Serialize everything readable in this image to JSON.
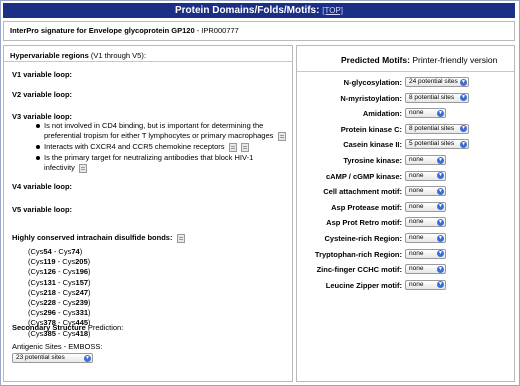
{
  "header": {
    "title": "Protein Domains/Folds/Motifs:",
    "top_link": "[TOP]"
  },
  "signature": {
    "title": "InterPro signature for Envelope glycoprotein GP120",
    "id": " - IPR000777"
  },
  "left": {
    "hypervariable_title": "Hypervariable regions",
    "hypervariable_sub": " (V1 through V5):",
    "loops": {
      "v1": "V1 variable loop:",
      "v2": "V2 variable loop:",
      "v3": "V3 variable loop:",
      "v4": "V4 variable loop:",
      "v5": "V5 variable loop:"
    },
    "v3_bullets": [
      "Is not involved in CD4 binding, but is important for determining the preferential tropism for either T lymphocytes or primary macrophages",
      "Interacts with CXCR4 and CCR5 chemokine receptors",
      "Is the primary target for neutralizing antibodies that block HIV-1 infectivity"
    ],
    "disulfide_title": "Highly conserved intrachain disulfide bonds:",
    "bonds": [
      {
        "open": "(Cys",
        "a": "54",
        "mid": " - Cys",
        "b": "74",
        "close": ")"
      },
      {
        "open": "(Cys",
        "a": "119",
        "mid": " - Cys",
        "b": "205",
        "close": ")"
      },
      {
        "open": "(Cys",
        "a": "126",
        "mid": " - Cys",
        "b": "196",
        "close": ")"
      },
      {
        "open": "(Cys",
        "a": "131",
        "mid": " - Cys",
        "b": "157",
        "close": ")"
      },
      {
        "open": "(Cys",
        "a": "218",
        "mid": " - Cys",
        "b": "247",
        "close": ")"
      },
      {
        "open": "(Cys",
        "a": "228",
        "mid": " - Cys",
        "b": "239",
        "close": ")"
      },
      {
        "open": "(Cys",
        "a": "296",
        "mid": " - Cys",
        "b": "331",
        "close": ")"
      },
      {
        "open": "(Cys",
        "a": "378",
        "mid": " - Cys",
        "b": "445",
        "close": ")"
      },
      {
        "open": "(Cys",
        "a": "385",
        "mid": " - Cys",
        "b": "418",
        "close": ")"
      }
    ],
    "secondary_title": "Secondary Structure",
    "secondary_sub": " Prediction:",
    "antigenic_label": "Antigenic Sites - EMBOSS:",
    "antigenic_value": "23 potential sites"
  },
  "right": {
    "title": "Predicted Motifs:",
    "printer_link": " Printer-friendly version",
    "motifs": [
      {
        "label": "N-glycosylation:",
        "value": "24 potential sites"
      },
      {
        "label": "N-myristoylation:",
        "value": "8 potential sites"
      },
      {
        "label": "Amidation:",
        "value": "none"
      },
      {
        "label": "Protein kinase C:",
        "value": "8 potential sites"
      },
      {
        "label": "Casein kinase II:",
        "value": "5 potential sites"
      },
      {
        "label": "Tyrosine kinase:",
        "value": "none"
      },
      {
        "label": "cAMP / cGMP kinase:",
        "value": "none"
      },
      {
        "label": "Cell attachment motif:",
        "value": "none"
      },
      {
        "label": "Asp Protease motif:",
        "value": "none"
      },
      {
        "label": "Asp Prot Retro motif:",
        "value": "none"
      },
      {
        "label": "Cysteine-rich Region:",
        "value": "none"
      },
      {
        "label": "Tryptophan-rich Region:",
        "value": "none"
      },
      {
        "label": "Zinc-finger CCHC motif:",
        "value": "none"
      },
      {
        "label": "Leucine Zipper motif:",
        "value": "none"
      }
    ]
  },
  "colors": {
    "title_bar": "#1b2f86",
    "select_arrow": "#3b6fd6"
  },
  "icons": {
    "document": "doc-icon",
    "dropdown": "chevron-down-icon"
  }
}
